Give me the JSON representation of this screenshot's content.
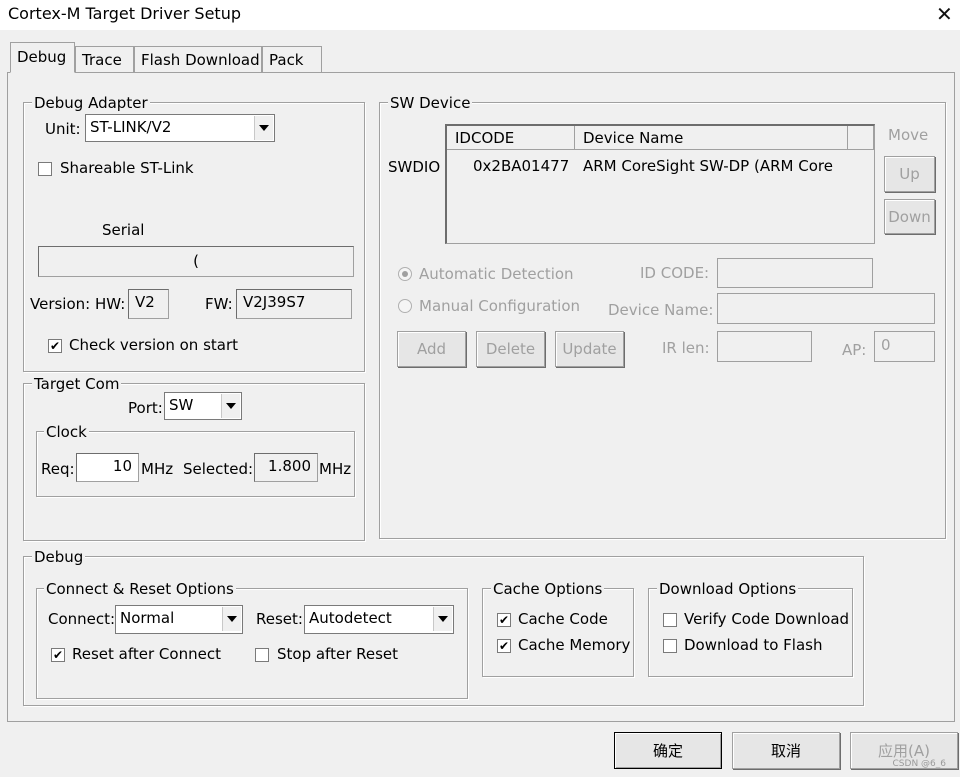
{
  "window": {
    "title": "Cortex-M Target Driver Setup"
  },
  "tabs": [
    "Debug",
    "Trace",
    "Flash Download",
    "Pack"
  ],
  "debug_adapter": {
    "label": "Debug Adapter",
    "unit_label": "Unit:",
    "unit_value": "ST-LINK/V2",
    "shareable_label": "Shareable ST-Link",
    "shareable_checked": false,
    "serial_label": "Serial",
    "serial_value": "(",
    "version_label": "Version: HW:",
    "hw_value": "V2",
    "fw_label": "FW:",
    "fw_value": "V2J39S7",
    "check_version_label": "Check version on start",
    "check_version_checked": true
  },
  "target_com": {
    "label": "Target Com",
    "port_label": "Port:",
    "port_value": "SW",
    "clock": {
      "label": "Clock",
      "req_label": "Req:",
      "req_value": "10",
      "req_unit": "MHz",
      "selected_label": "Selected:",
      "selected_value": "1.800",
      "selected_unit": "MHz"
    }
  },
  "sw_device": {
    "label": "SW Device",
    "columns": [
      "IDCODE",
      "Device Name"
    ],
    "row_label": "SWDIO",
    "rows": [
      {
        "idcode": "0x2BA01477",
        "name": "ARM CoreSight SW-DP (ARM Core"
      }
    ],
    "move_label": "Move",
    "up_label": "Up",
    "down_label": "Down",
    "auto_label": "Automatic Detection",
    "manual_label": "Manual Configuration",
    "id_code_label": "ID CODE:",
    "device_name_label": "Device Name:",
    "ir_len_label": "IR len:",
    "ap_label": "AP:",
    "ap_value": "0",
    "add_label": "Add",
    "delete_label": "Delete",
    "update_label": "Update"
  },
  "debug": {
    "label": "Debug",
    "connect_reset": {
      "label": "Connect & Reset Options",
      "connect_label": "Connect:",
      "connect_value": "Normal",
      "reset_label": "Reset:",
      "reset_value": "Autodetect",
      "reset_after_label": "Reset after Connect",
      "reset_after_checked": true,
      "stop_after_label": "Stop after Reset",
      "stop_after_checked": false
    },
    "cache": {
      "label": "Cache Options",
      "code_label": "Cache Code",
      "code_checked": true,
      "memory_label": "Cache Memory",
      "memory_checked": true
    },
    "download": {
      "label": "Download Options",
      "verify_label": "Verify Code Download",
      "verify_checked": false,
      "flash_label": "Download to Flash",
      "flash_checked": false
    }
  },
  "footer": {
    "ok": "确定",
    "cancel": "取消",
    "apply": "应用(A)"
  },
  "watermark": "CSDN @6_6"
}
